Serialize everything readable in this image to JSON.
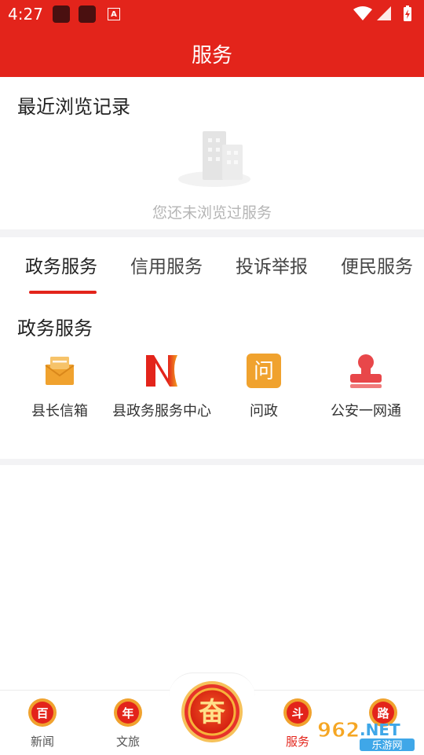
{
  "status_bar": {
    "time": "4:27",
    "a_icon": "A",
    "icons": [
      "wifi-icon",
      "signal-icon",
      "battery-icon"
    ]
  },
  "header": {
    "title": "服务"
  },
  "recent": {
    "title": "最近浏览记录",
    "empty_text": "您还未浏览过服务"
  },
  "tabs": [
    {
      "label": "政务服务",
      "active": true
    },
    {
      "label": "信用服务",
      "active": false
    },
    {
      "label": "投诉举报",
      "active": false
    },
    {
      "label": "便民服务",
      "active": false
    }
  ],
  "gov_section": {
    "title": "政务服务",
    "items": [
      {
        "label": "县长信箱",
        "icon": "mailbox-icon"
      },
      {
        "label": "县政务服务中心",
        "icon": "n-logo-icon"
      },
      {
        "label": "问政",
        "icon": "wenzheng-icon",
        "icon_text": "问"
      },
      {
        "label": "公安一网通",
        "icon": "stamp-icon"
      }
    ]
  },
  "bottom_nav": {
    "items": [
      {
        "label": "新闻",
        "icon_text": "百"
      },
      {
        "label": "文旅",
        "icon_text": "年"
      },
      {
        "label": "服务",
        "icon_text": "斗",
        "active": true
      },
      {
        "label": "",
        "icon_text": "路"
      }
    ],
    "center_text": "奋"
  },
  "watermark": {
    "number": "962",
    "suffix": ".NET",
    "site": "乐游网"
  },
  "colors": {
    "brand_red": "#e3241b",
    "orange": "#f0a22e",
    "gray_text": "#b5b5b5"
  }
}
